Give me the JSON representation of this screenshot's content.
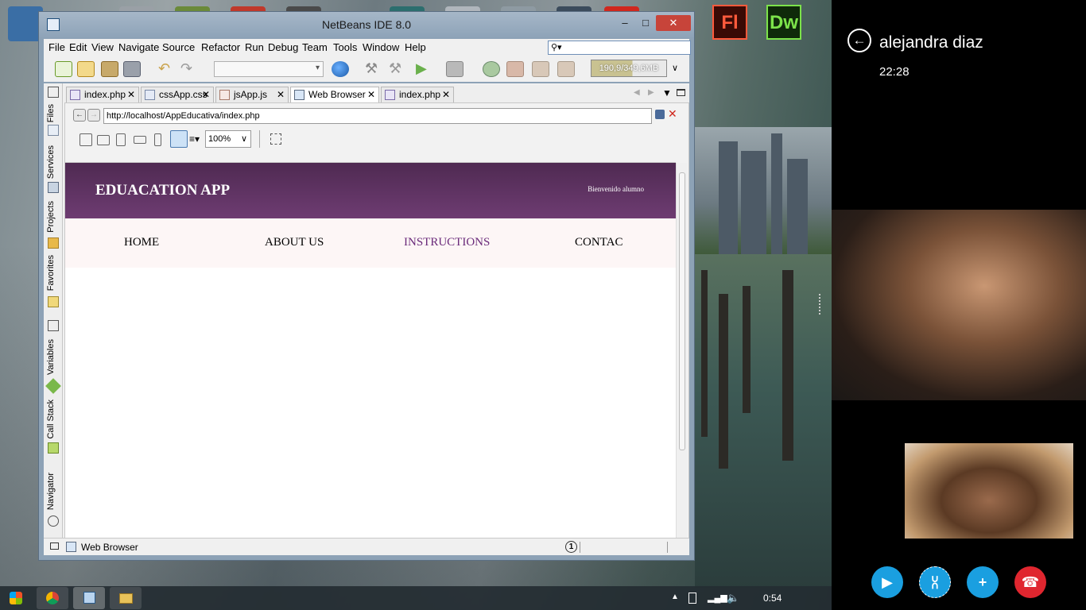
{
  "window": {
    "title": "NetBeans IDE 8.0",
    "minimize": "–",
    "maximize": "□",
    "close": "✕"
  },
  "menu": [
    "File",
    "Edit",
    "View",
    "Navigate",
    "Source",
    "Refactor",
    "Run",
    "Debug",
    "Team",
    "Tools",
    "Window",
    "Help"
  ],
  "toolbar": {
    "memory": "190,9/349,6MB"
  },
  "side_tabs": [
    "Files",
    "Services",
    "Projects",
    "Favorites",
    "Variables",
    "Call Stack",
    "Navigator"
  ],
  "editor_tabs": [
    {
      "label": "index.php",
      "active": false
    },
    {
      "label": "cssApp.css",
      "active": false
    },
    {
      "label": "jsApp.js",
      "active": false
    },
    {
      "label": "Web Browser",
      "active": true
    },
    {
      "label": "index.php",
      "active": false
    }
  ],
  "browser": {
    "url": "http://localhost/AppEducativa/index.php",
    "zoom": "100%"
  },
  "site": {
    "title": "EDUACATION APP",
    "welcome": "Bienvenido alumno",
    "nav": [
      "HOME",
      "ABOUT US",
      "INSTRUCTIONS",
      "CONTAC"
    ],
    "active_nav": "INSTRUCTIONS",
    "header_color": "#5a2e5e",
    "active_color": "#6a2a7a"
  },
  "status_bar": {
    "label": "Web Browser",
    "notifications": "1"
  },
  "desktop_apps": {
    "flash": "Fl",
    "dreamweaver": "Dw"
  },
  "taskbar": {
    "clock": "0:54"
  },
  "skype": {
    "contact": "alejandra diaz",
    "time": "22:28",
    "accent": "#1a9fe0",
    "hangup_color": "#e0262f"
  }
}
